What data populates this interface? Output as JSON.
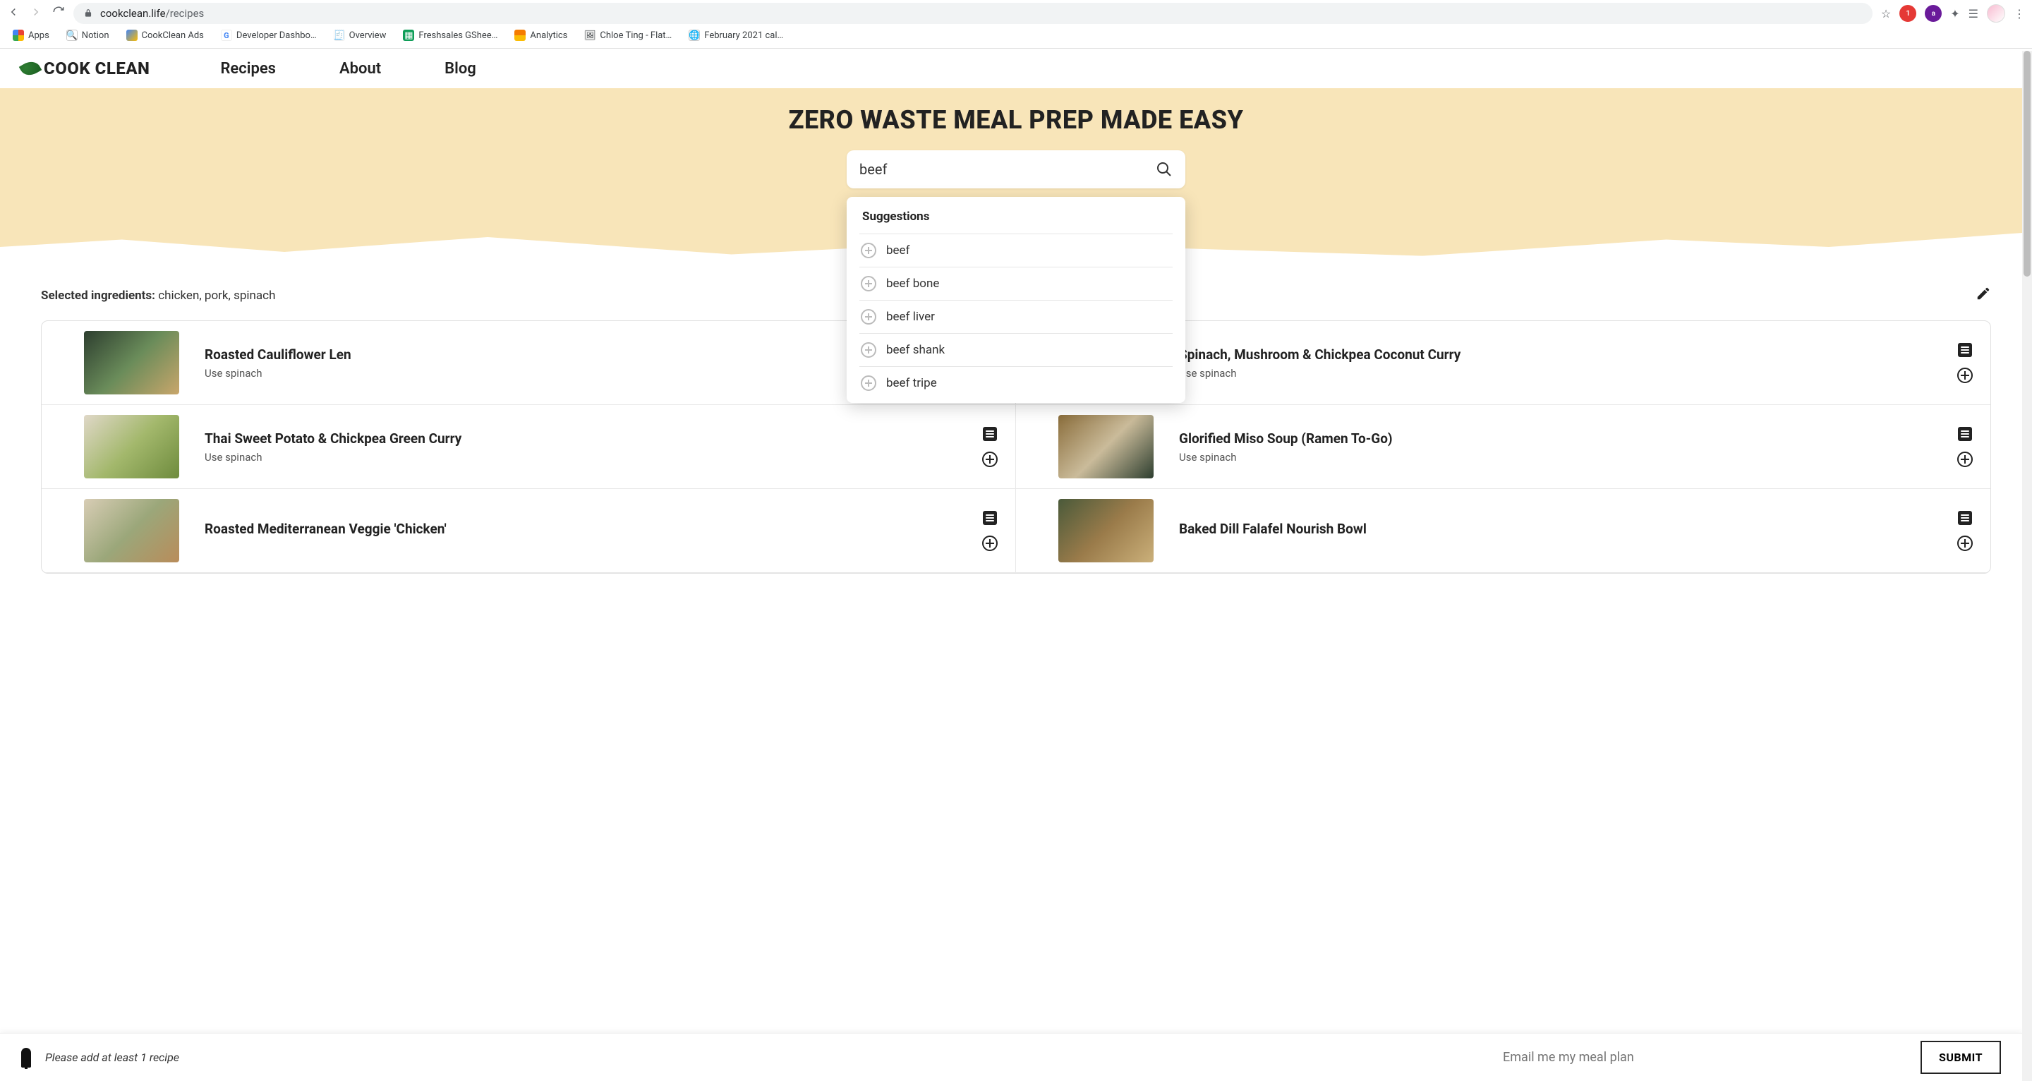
{
  "browser": {
    "url_host": "cookclean.life",
    "url_path": "/recipes",
    "bookmarks": [
      "Apps",
      "Notion",
      "CookClean Ads",
      "Developer Dashbo…",
      "Overview",
      "Freshsales GShee…",
      "Analytics",
      "Chloe Ting - Flat…",
      "February 2021 cal…"
    ]
  },
  "header": {
    "logo": "COOK CLEAN",
    "nav": [
      "Recipes",
      "About",
      "Blog"
    ]
  },
  "hero": {
    "title": "ZERO WASTE MEAL PREP MADE EASY",
    "search_value": "beef"
  },
  "suggestions": {
    "title": "Suggestions",
    "items": [
      "beef",
      "beef bone",
      "beef liver",
      "beef shank",
      "beef tripe"
    ]
  },
  "selected": {
    "label": "Selected ingredients:",
    "value": "chicken, pork, spinach"
  },
  "recipes": [
    {
      "title": "Roasted Cauliflower Len",
      "sub": "Use spinach",
      "thumb": "t1"
    },
    {
      "title": "Spinach, Mushroom & Chickpea Coconut Curry",
      "sub": "Use spinach",
      "thumb": "t2"
    },
    {
      "title": "Thai Sweet Potato & Chickpea Green Curry",
      "sub": "Use spinach",
      "thumb": "t3"
    },
    {
      "title": "Glorified Miso Soup (Ramen To-Go)",
      "sub": "Use spinach",
      "thumb": "t4"
    },
    {
      "title": "Roasted Mediterranean Veggie 'Chicken'",
      "sub": "",
      "thumb": "t5"
    },
    {
      "title": "Baked Dill Falafel Nourish Bowl",
      "sub": "",
      "thumb": "t6"
    }
  ],
  "bottom": {
    "hint": "Please add at least 1 recipe",
    "email_placeholder": "Email me my meal plan",
    "submit": "SUBMIT"
  }
}
